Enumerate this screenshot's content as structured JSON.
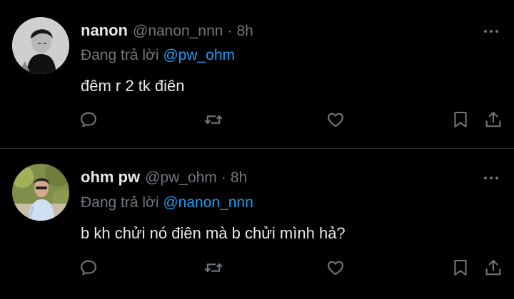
{
  "colors": {
    "background": "#000000",
    "primary_text": "#e7e9ea",
    "secondary_text": "#71767b",
    "link": "#1d9bf0",
    "divider": "#2f3336"
  },
  "tweets": [
    {
      "display_name": "nanon",
      "handle": "@nanon_nnn",
      "separator": "·",
      "time": "8h",
      "replying_prefix": "Đang trả lời",
      "replying_to": "@pw_ohm",
      "text": "đêm r 2 tk điên",
      "avatar": "grayscale-portrait-avatar"
    },
    {
      "display_name": "ohm pw",
      "handle": "@pw_ohm",
      "separator": "·",
      "time": "8h",
      "replying_prefix": "Đang trả lời",
      "replying_to": "@nanon_nnn",
      "text": "b kh chửi nó điên mà b chửi mình hả?",
      "avatar": "outdoor-portrait-avatar"
    }
  ],
  "icons": [
    "reply-icon",
    "retweet-icon",
    "like-icon",
    "bookmark-icon",
    "share-icon",
    "more-icon"
  ]
}
